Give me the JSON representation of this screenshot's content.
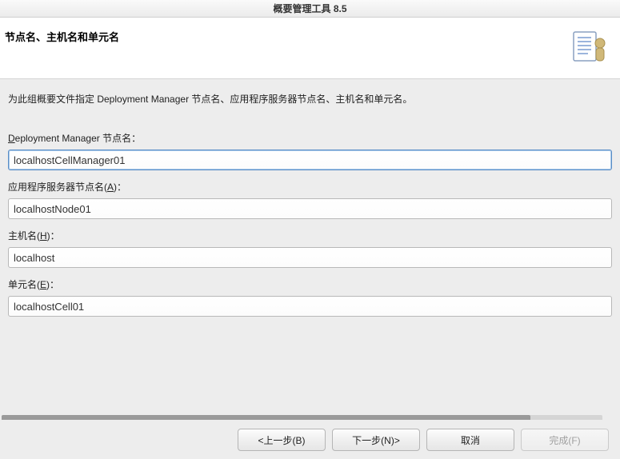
{
  "window": {
    "title": "概要管理工具 8.5"
  },
  "header": {
    "title": "节点名、主机名和单元名"
  },
  "content": {
    "description": "为此组概要文件指定 Deployment Manager 节点名、应用程序服务器节点名、主机名和单元名。",
    "fields": {
      "dmgr_node": {
        "label_prefix": "",
        "label_underline": "D",
        "label_suffix": "eployment Manager 节点名：",
        "value": "localhostCellManager01"
      },
      "app_node": {
        "label_prefix": "应用程序服务器节点名(",
        "label_underline": "A",
        "label_suffix": ")：",
        "value": "localhostNode01"
      },
      "host": {
        "label_prefix": "主机名(",
        "label_underline": "H",
        "label_suffix": ")：",
        "value": "localhost"
      },
      "cell": {
        "label_prefix": "单元名(",
        "label_underline": "E",
        "label_suffix": ")：",
        "value": "localhostCell01"
      }
    }
  },
  "footer": {
    "back": "<上一步(B)",
    "next": "下一步(N)>",
    "cancel": "取消",
    "finish": "完成(F)"
  }
}
